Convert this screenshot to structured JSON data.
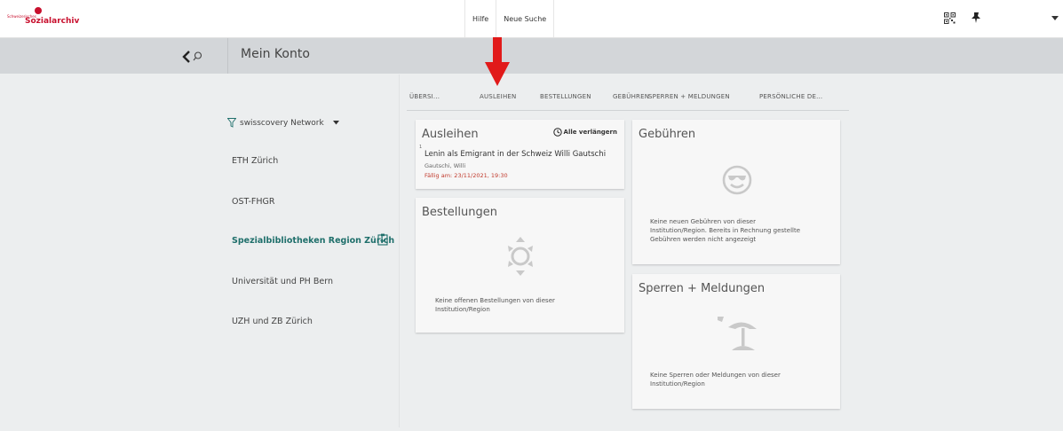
{
  "header": {
    "logo_small": "Schweizerisches",
    "logo_name": "Sozialarchiv",
    "nav": [
      "Hilfe",
      "Neue Suche"
    ],
    "icons": [
      "qr-code-icon",
      "pin-icon",
      "chevron-down-icon"
    ]
  },
  "subheader": {
    "title": "Mein Konto",
    "icons": [
      "chevron-left-icon",
      "search-icon"
    ]
  },
  "sidebar": {
    "filter_label": "swisscovery Network",
    "institutions": [
      {
        "label": "ETH Zürich"
      },
      {
        "label": "OST-FHGR"
      },
      {
        "label": "Spezialbibliotheken Region Zürich",
        "active": true
      },
      {
        "label": "Universität und PH Bern"
      },
      {
        "label": "UZH und ZB Zürich"
      }
    ]
  },
  "tabs": [
    "ÜBERSI...",
    "AUSLEIHEN",
    "BESTELLUNGEN",
    "GEBÜHREN",
    "SPERREN + MELDUNGEN",
    "PERSÖNLICHE DE..."
  ],
  "loans": {
    "title": "Ausleihen",
    "renew_all": "Alle verlängern",
    "items": [
      {
        "num": "1",
        "title": "Lenin als Emigrant in der Schweiz Willi Gautschi",
        "author": "Gautschi, Willi",
        "due": "Fällig am: 23/11/2021, 19:30"
      }
    ]
  },
  "orders": {
    "title": "Bestellungen",
    "empty_line1": "Keine offenen Bestellungen von dieser",
    "empty_line2": "Institution/Region"
  },
  "fees": {
    "title": "Gebühren",
    "empty_line1": "Keine neuen Gebühren von dieser",
    "empty_line2": "Institution/Region. Bereits in Rechnung gestellte",
    "empty_line3": "Gebühren werden nicht angezeigt"
  },
  "blocks": {
    "title": "Sperren + Meldungen",
    "empty_line1": "Keine Sperren oder Meldungen von dieser",
    "empty_line2": "Institution/Region"
  },
  "colors": {
    "accent_teal": "#1f6f6b",
    "brand_red": "#c8102e",
    "due_red": "#c0392b",
    "arrow_red": "#e11a1a"
  }
}
